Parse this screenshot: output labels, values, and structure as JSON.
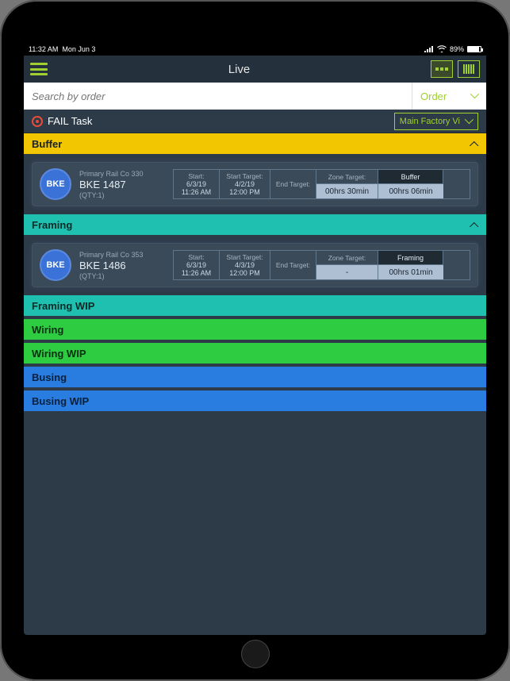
{
  "statusbar": {
    "time": "11:32 AM",
    "date": "Mon Jun 3",
    "battery_pct": "89%"
  },
  "navbar": {
    "title": "Live"
  },
  "search": {
    "placeholder": "Search by order",
    "filter_label": "Order"
  },
  "taskrow": {
    "fail_label": "FAIL Task",
    "view_label": "Main Factory Vi"
  },
  "sections": [
    {
      "id": "buffer",
      "label": "Buffer",
      "color": "sec-yellow",
      "expanded": true,
      "card": {
        "badge": "BKE",
        "company": "Primary Rail Co 330",
        "order": "BKE 1487",
        "qty": "(QTY:1)",
        "start_lbl": "Start:",
        "start_date": "6/3/19",
        "start_time": "11:26 AM",
        "starttarget_lbl": "Start Target:",
        "starttarget_date": "4/2/19",
        "starttarget_time": "12:00 PM",
        "endtarget_lbl": "End Target:",
        "zonetarget_lbl": "Zone Target:",
        "zonetarget_val": "00hrs 30min",
        "zone_name": "Buffer",
        "zone_time": "00hrs 06min"
      }
    },
    {
      "id": "framing",
      "label": "Framing",
      "color": "sec-teal",
      "expanded": true,
      "card": {
        "badge": "BKE",
        "company": "Primary Rail Co 353",
        "order": "BKE 1486",
        "qty": "(QTY:1)",
        "start_lbl": "Start:",
        "start_date": "6/3/19",
        "start_time": "11:26 AM",
        "starttarget_lbl": "Start Target:",
        "starttarget_date": "4/3/19",
        "starttarget_time": "12:00 PM",
        "endtarget_lbl": "End Target:",
        "zonetarget_lbl": "Zone Target:",
        "zonetarget_val": "-",
        "zone_name": "Framing",
        "zone_time": "00hrs 01min"
      }
    },
    {
      "id": "framing-wip",
      "label": "Framing  WIP",
      "color": "sec-teal",
      "expanded": false
    },
    {
      "id": "wiring",
      "label": "Wiring",
      "color": "sec-green",
      "expanded": false
    },
    {
      "id": "wiring-wip",
      "label": "Wiring WIP",
      "color": "sec-green",
      "expanded": false
    },
    {
      "id": "busing",
      "label": "Busing",
      "color": "sec-blue",
      "expanded": false
    },
    {
      "id": "busing-wip",
      "label": "Busing WIP",
      "color": "sec-blue",
      "expanded": false
    }
  ]
}
